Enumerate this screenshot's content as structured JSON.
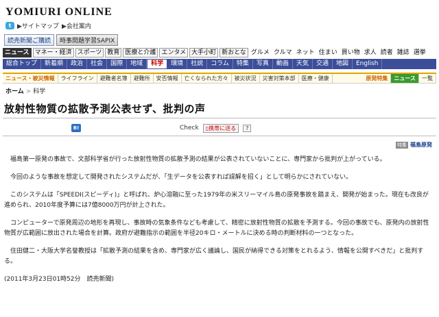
{
  "header": {
    "logo": "YOMIURI ONLINE",
    "twitter_label": "t",
    "sitemap": "サイトマップ",
    "company": "会社案内",
    "buttons": [
      "読売新聞ご購読",
      "時事問題学習SAPIX"
    ]
  },
  "nav_primary": [
    "ニュース",
    "マネー・経済",
    "スポーツ",
    "教育",
    "医療と介護",
    "エンタメ",
    "大手小町",
    "新おとな",
    "グルメ",
    "クルマ",
    "ネット",
    "住まい",
    "買い物",
    "求人",
    "読者",
    "雑誌",
    "選挙"
  ],
  "nav_secondary": [
    "総合トップ",
    "新着順",
    "政治",
    "社会",
    "国際",
    "地域",
    "科学",
    "環境",
    "社説",
    "コラム",
    "特集",
    "写真",
    "動画",
    "天気",
    "交通",
    "地図",
    "English"
  ],
  "nav_secondary_active": "科学",
  "nav_disaster": {
    "head": "ニュース・被災情報",
    "items": [
      "ライフライン",
      "避難者名簿",
      "避難所",
      "安否情報",
      "亡くなられた方々",
      "被災状況",
      "災害対策本部",
      "医療・健康"
    ],
    "right_head": "原発特集",
    "right_items": [
      "ニュース",
      "一覧"
    ]
  },
  "breadcrumb": {
    "home": "ホーム",
    "section": "科学"
  },
  "article": {
    "title": "放射性物質の拡散予測公表せず、批判の声",
    "share_b": "B!",
    "check": "Check",
    "mobile_send": "携帯に送る",
    "question": "?",
    "tag_badge": "特集",
    "tag_keyword": "福島原発",
    "paragraphs": [
      "福島第一原発の事故で、文部科学省が行った放射性物質の拡散予測の結果が公表されていないことに、専門家から批判が上がっている。",
      "今回のような事故を想定して開発されたシステムだが、「生データを公表すれば誤解を招く」として明らかにされていない。",
      "このシステムは「SPEEDI(スピーディ)」と呼ばれ、炉心溶融に至った1979年の米スリーマイル島の原発事故を踏まえ、開発が始まった。現在も改良が進められ、2010年度予算には7億8000万円が計上された。",
      "コンピューターで原発周辺の地形を再現し、事故時の気象条件なども考慮して、精密に放射性物質の拡散を予測する。今回の事故でも、原発内の放射性物質が広範囲に放出された場合を計算。政府が避難指示の範囲を半径20キロ・メートルに決める時の判断材料の一つとなった。",
      "住田健二・大阪大学名誉教授は「拡散予測の結果を含め、専門家が広く議論し、国民が納得できる対策をとれるよう、情報を公開すべきだ」と批判する。"
    ],
    "date": "(2011年3月23日01時52分　読売新聞)"
  }
}
